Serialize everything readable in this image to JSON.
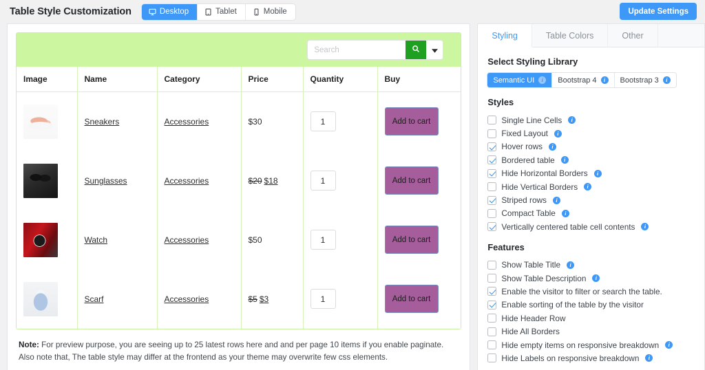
{
  "header": {
    "title": "Table Style Customization",
    "devices": [
      {
        "label": "Desktop",
        "icon": "desktop-icon",
        "active": true
      },
      {
        "label": "Tablet",
        "icon": "tablet-icon",
        "active": false
      },
      {
        "label": "Mobile",
        "icon": "mobile-icon",
        "active": false
      }
    ],
    "update_button": "Update Settings"
  },
  "preview": {
    "search": {
      "placeholder": "Search",
      "value": "",
      "search_icon": "magnifier-icon",
      "caret_icon": "caret-down-icon"
    },
    "columns": [
      "Image",
      "Name",
      "Category",
      "Price",
      "Quantity",
      "Buy"
    ],
    "rows": [
      {
        "image": "sneakers-thumbnail",
        "name": "Sneakers",
        "category": "Accessories",
        "price_old": "",
        "price": "$30",
        "qty": "1",
        "buy": "Add to cart"
      },
      {
        "image": "sunglasses-thumbnail",
        "name": "Sunglasses",
        "category": "Accessories",
        "price_old": "$20",
        "price": "$18",
        "qty": "1",
        "buy": "Add to cart"
      },
      {
        "image": "watch-thumbnail",
        "name": "Watch",
        "category": "Accessories",
        "price_old": "",
        "price": "$50",
        "qty": "1",
        "buy": "Add to cart"
      },
      {
        "image": "scarf-thumbnail",
        "name": "Scarf",
        "category": "Accessories",
        "price_old": "$5",
        "price": "$3",
        "qty": "1",
        "buy": "Add to cart"
      }
    ],
    "note_label": "Note:",
    "note_text": " For preview purpose, you are seeing up to 25 latest rows here and and per page 10 items if you enable paginate. Also note that, The table style may differ at the frontend as your theme may overwrite few css elements."
  },
  "settings": {
    "tabs": [
      {
        "label": "Styling",
        "active": true
      },
      {
        "label": "Table Colors",
        "active": false
      },
      {
        "label": "Other",
        "active": false
      }
    ],
    "library_title": "Select Styling Library",
    "libraries": [
      {
        "label": "Semantic UI",
        "active": true,
        "info": true
      },
      {
        "label": "Bootstrap 4",
        "active": false,
        "info": true
      },
      {
        "label": "Bootstrap 3",
        "active": false,
        "info": true
      }
    ],
    "styles_title": "Styles",
    "styles": [
      {
        "label": "Single Line Cells",
        "checked": false,
        "info": true
      },
      {
        "label": "Fixed Layout",
        "checked": false,
        "info": true
      },
      {
        "label": "Hover rows",
        "checked": true,
        "info": true
      },
      {
        "label": "Bordered table",
        "checked": true,
        "info": true
      },
      {
        "label": "Hide Horizontal Borders",
        "checked": true,
        "info": true
      },
      {
        "label": "Hide Vertical Borders",
        "checked": false,
        "info": true
      },
      {
        "label": "Striped rows",
        "checked": true,
        "info": true
      },
      {
        "label": "Compact Table",
        "checked": false,
        "info": true
      },
      {
        "label": "Vertically centered table cell contents",
        "checked": true,
        "info": true
      }
    ],
    "features_title": "Features",
    "features": [
      {
        "label": "Show Table Title",
        "checked": false,
        "info": true
      },
      {
        "label": "Show Table Description",
        "checked": false,
        "info": true
      },
      {
        "label": "Enable the visitor to filter or search the table.",
        "checked": true,
        "info": false
      },
      {
        "label": "Enable sorting of the table by the visitor",
        "checked": true,
        "info": false
      },
      {
        "label": "Hide Header Row",
        "checked": false,
        "info": false
      },
      {
        "label": "Hide All Borders",
        "checked": false,
        "info": false
      },
      {
        "label": "Hide empty items on responsive breakdown",
        "checked": false,
        "info": true
      },
      {
        "label": "Hide Labels on responsive breakdown",
        "checked": false,
        "info": true
      }
    ]
  },
  "colors": {
    "accent": "#3e98f7",
    "table_header_bar": "#ccf7a0",
    "table_border": "#d6f4b8",
    "search_button": "#20a020",
    "cart_button": "#a55e9b"
  }
}
